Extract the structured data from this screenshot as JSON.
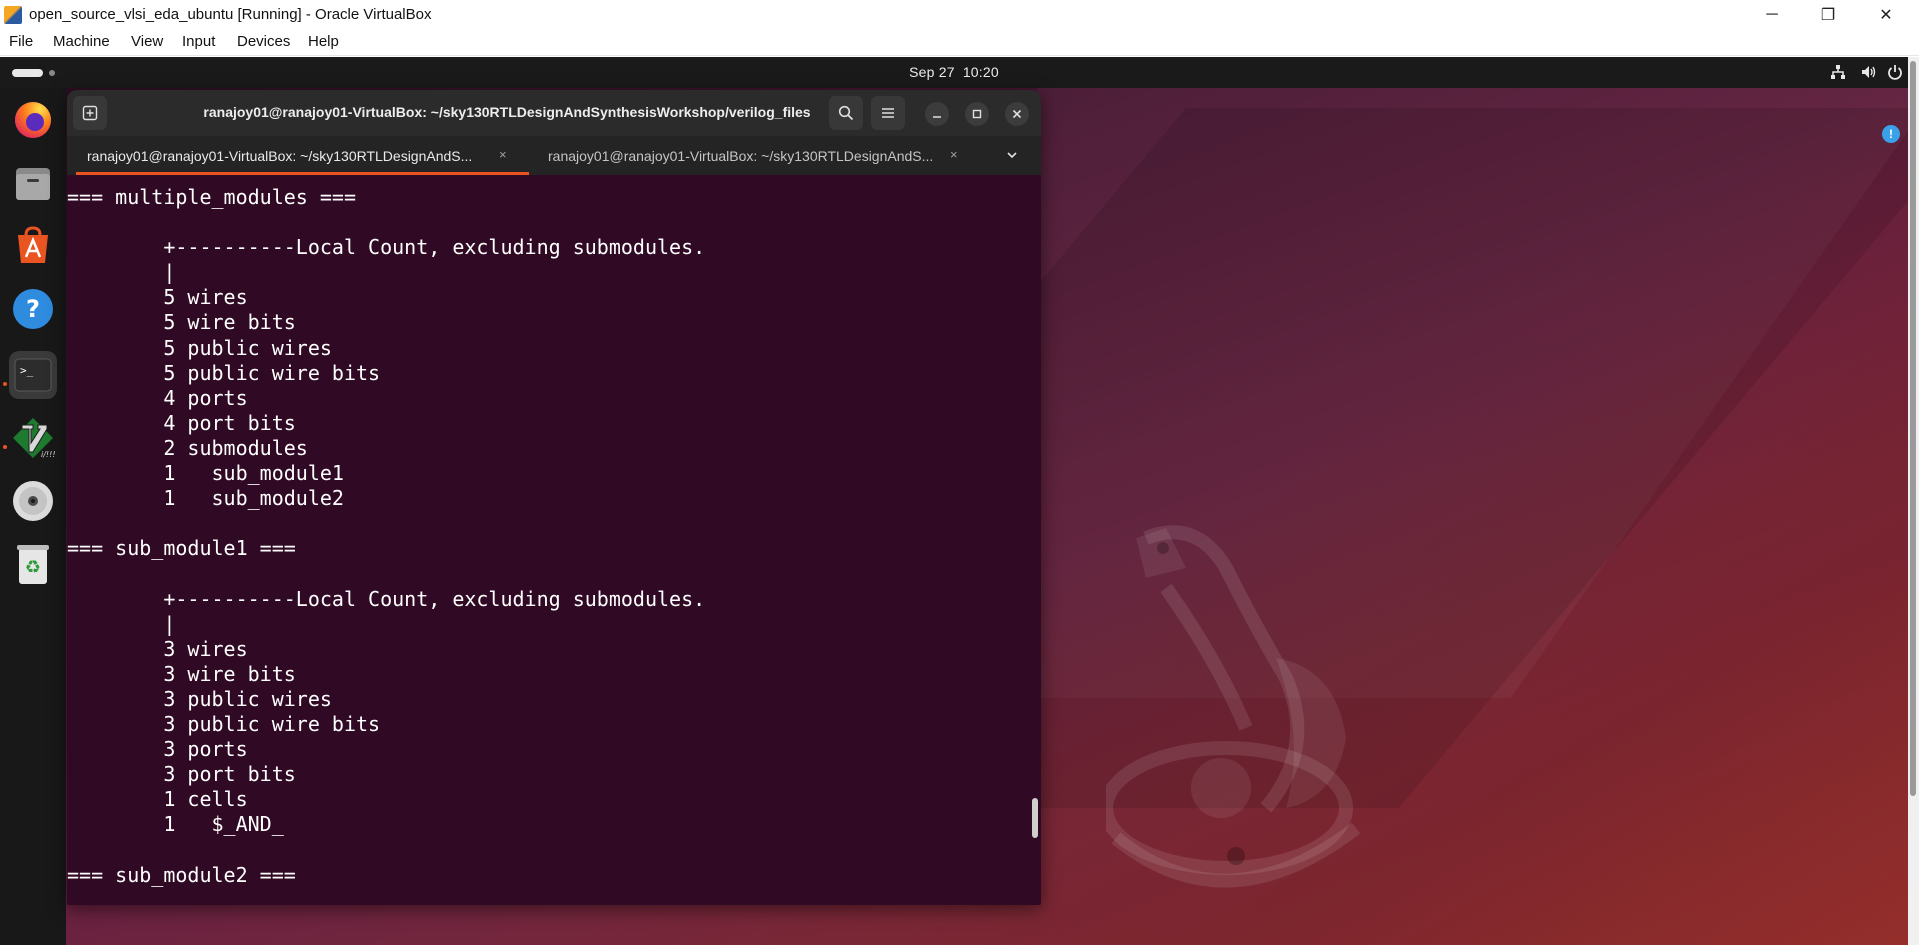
{
  "host_window": {
    "title": "open_source_vlsi_eda_ubuntu [Running] - Oracle VirtualBox",
    "controls": {
      "minimize": "─",
      "maximize": "❐",
      "close": "✕"
    },
    "menu": [
      "File",
      "Machine",
      "View",
      "Input",
      "Devices",
      "Help"
    ]
  },
  "gnome_top_bar": {
    "date": "Sep 27",
    "time": "10:20",
    "tray_icons": [
      "network-icon",
      "volume-icon",
      "power-icon"
    ]
  },
  "dock": {
    "apps": [
      {
        "name": "firefox",
        "icon": "firefox-icon"
      },
      {
        "name": "files",
        "icon": "files-icon"
      },
      {
        "name": "app-center",
        "icon": "app-center-icon"
      },
      {
        "name": "help",
        "icon": "help-icon",
        "glyph": "?"
      },
      {
        "name": "terminal",
        "icon": "terminal-icon",
        "glyph": ">_",
        "active": true
      },
      {
        "name": "gvim",
        "icon": "vim-icon",
        "glyph": "V"
      },
      {
        "name": "disc",
        "icon": "disc-icon"
      },
      {
        "name": "trash",
        "icon": "trash-icon",
        "glyph": "♻"
      }
    ]
  },
  "terminal": {
    "title": "ranajoy01@ranajoy01-VirtualBox: ~/sky130RTLDesignAndSynthesisWorkshop/verilog_files",
    "tabs": [
      {
        "label": "ranajoy01@ranajoy01-VirtualBox: ~/sky130RTLDesignAndS...",
        "close": "×",
        "active": true
      },
      {
        "label": "ranajoy01@ranajoy01-VirtualBox: ~/sky130RTLDesignAndS...",
        "close": "×",
        "active": false
      }
    ],
    "output_lines": [
      "=== multiple_modules ===",
      "",
      "        +----------Local Count, excluding submodules.",
      "        |",
      "        5 wires",
      "        5 wire bits",
      "        5 public wires",
      "        5 public wire bits",
      "        4 ports",
      "        4 port bits",
      "        2 submodules",
      "        1   sub_module1",
      "        1   sub_module2",
      "",
      "=== sub_module1 ===",
      "",
      "        +----------Local Count, excluding submodules.",
      "        |",
      "        3 wires",
      "        3 wire bits",
      "        3 public wires",
      "        3 public wire bits",
      "        3 ports",
      "        3 port bits",
      "        1 cells",
      "        1   $_AND_",
      "",
      "=== sub_module2 ==="
    ]
  }
}
